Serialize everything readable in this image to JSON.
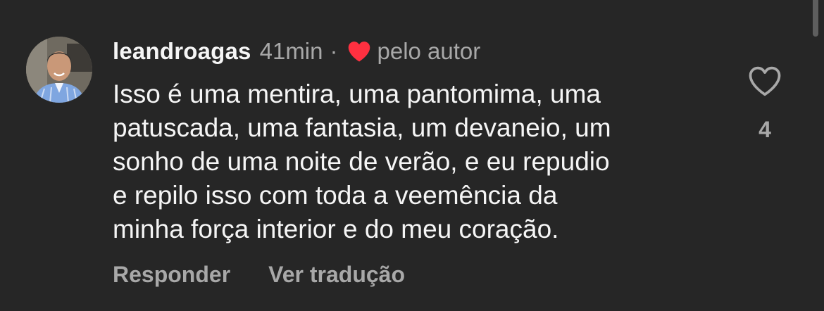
{
  "comment": {
    "username": "leandroagas",
    "time": "41min",
    "separator": "·",
    "liked_by_author_label": "pelo autor",
    "text_lines": [
      "Isso é uma mentira, uma pantomima, uma",
      "patuscada, uma fantasia, um devaneio, um",
      "sonho de uma noite de verão, e eu repudio",
      "e repilo isso com toda a veemência da",
      "minha força interior e do meu coração."
    ],
    "like_count": "4",
    "actions": {
      "reply_label": "Responder",
      "translate_label": "Ver tradução"
    }
  },
  "icons": {
    "author_like": "heart-filled-icon",
    "like": "heart-outline-icon"
  },
  "colors": {
    "background": "#262626",
    "primary_text": "#f5f5f5",
    "secondary_text": "#a8a8a8",
    "author_heart": "#ff3040"
  }
}
